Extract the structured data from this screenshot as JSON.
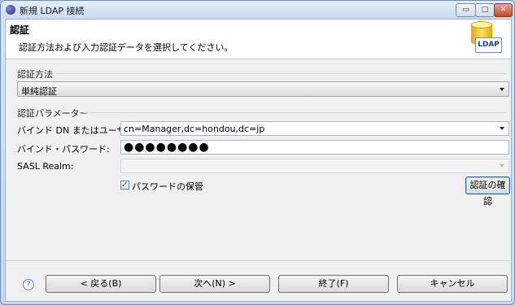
{
  "window": {
    "title": "新規 LDAP 接続",
    "controls": {
      "minimize": "▭",
      "maximize": "□",
      "close": "✕"
    }
  },
  "banner": {
    "title": "認証",
    "description": "認証方法および入力認証データを選択してください。",
    "icon_label": "LDAP"
  },
  "auth_method": {
    "section_label": "認証方法",
    "selected": "単純認証"
  },
  "auth_params": {
    "section_label": "認証パラメーター",
    "bind_dn_label": "バインド DN またはユーザー:",
    "bind_dn_value": "cn=Manager,dc=hondou,dc=jp",
    "bind_password_label": "バインド・パスワード:",
    "bind_password_value": "●●●●●●●●",
    "sasl_realm_label": "SASL Realm:",
    "sasl_realm_value": "",
    "save_password_label": "パスワードの保管",
    "save_password_checked": true,
    "verify_button": "認証の確認"
  },
  "footer": {
    "help_icon": "?",
    "back": "< 戻る(B)",
    "next": "次へ(N) >",
    "finish": "終了(F)",
    "cancel": "キャンセル"
  }
}
